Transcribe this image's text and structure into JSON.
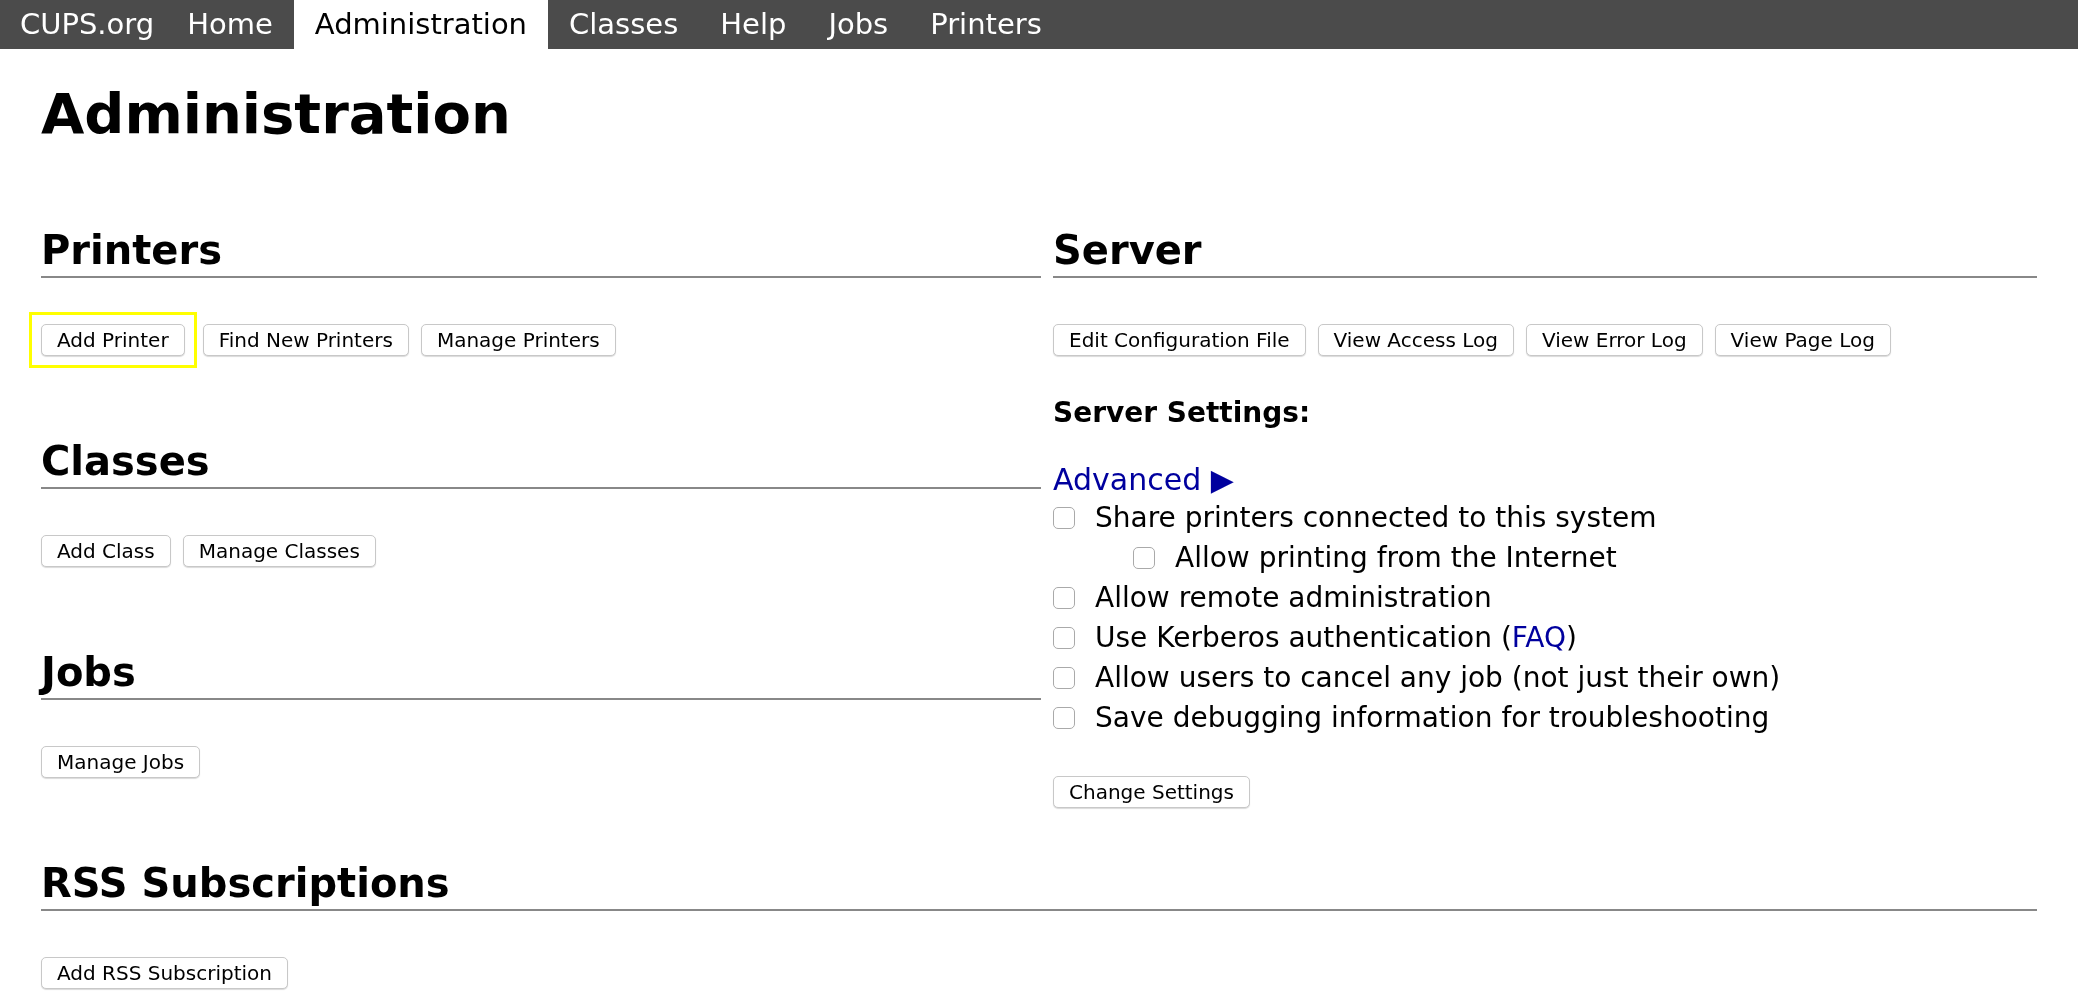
{
  "nav": {
    "brand": "CUPS.org",
    "tabs": [
      {
        "label": "Home",
        "selected": false
      },
      {
        "label": "Administration",
        "selected": true
      },
      {
        "label": "Classes",
        "selected": false
      },
      {
        "label": "Help",
        "selected": false
      },
      {
        "label": "Jobs",
        "selected": false
      },
      {
        "label": "Printers",
        "selected": false
      }
    ]
  },
  "title": "Administration",
  "left_sections": [
    {
      "heading": "Printers",
      "buttons": [
        {
          "label": "Add Printer",
          "highlighted": true
        },
        {
          "label": "Find New Printers",
          "highlighted": false
        },
        {
          "label": "Manage Printers",
          "highlighted": false
        }
      ]
    },
    {
      "heading": "Classes",
      "buttons": [
        {
          "label": "Add Class",
          "highlighted": false
        },
        {
          "label": "Manage Classes",
          "highlighted": false
        }
      ]
    },
    {
      "heading": "Jobs",
      "buttons": [
        {
          "label": "Manage Jobs",
          "highlighted": false
        }
      ]
    }
  ],
  "server": {
    "heading": "Server",
    "buttons": [
      {
        "label": "Edit Configuration File",
        "highlighted": false
      },
      {
        "label": "View Access Log",
        "highlighted": false
      },
      {
        "label": "View Error Log",
        "highlighted": false
      },
      {
        "label": "View Page Log",
        "highlighted": false
      }
    ],
    "settings_title": "Server Settings:",
    "advanced_link": "Advanced ▶",
    "options": [
      {
        "label": "Share printers connected to this system",
        "checked": false,
        "children": [
          {
            "label": "Allow printing from the Internet",
            "checked": false
          }
        ]
      },
      {
        "label": "Allow remote administration",
        "checked": false
      },
      {
        "label": "Use Kerberos authentication (",
        "link": "FAQ",
        "suffix": ")",
        "checked": false
      },
      {
        "label": "Allow users to cancel any job (not just their own)",
        "checked": false
      },
      {
        "label": "Save debugging information for troubleshooting",
        "checked": false
      }
    ],
    "submit": {
      "label": "Change Settings",
      "highlighted": false
    }
  },
  "rss": {
    "heading": "RSS Subscriptions",
    "buttons": [
      {
        "label": "Add RSS Subscription",
        "highlighted": false
      }
    ]
  }
}
